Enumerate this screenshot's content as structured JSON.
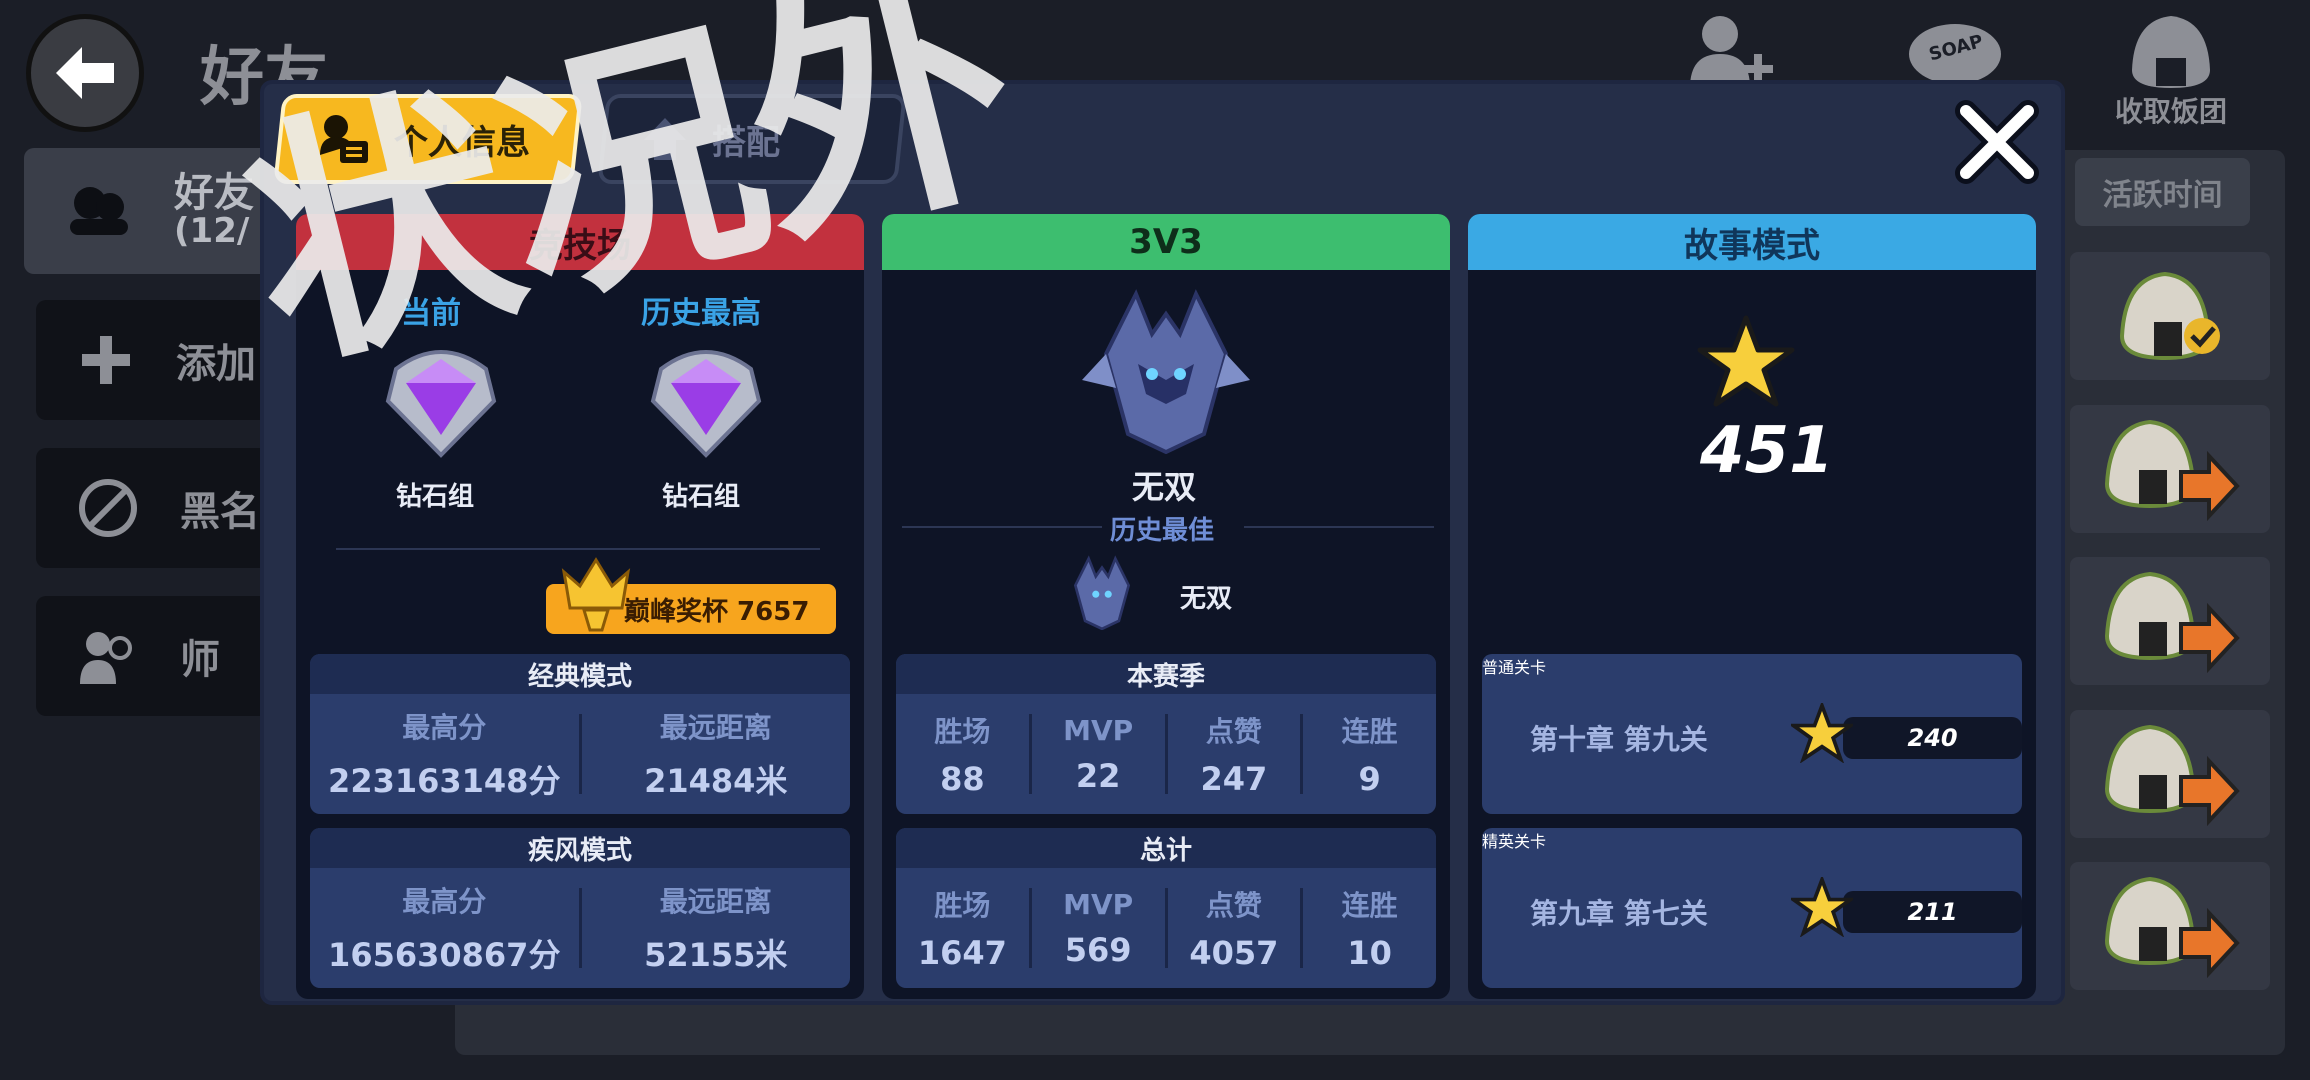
{
  "background": {
    "title": "好友",
    "top_icons": [
      {
        "name": "add-friend-icon",
        "label": ""
      },
      {
        "name": "soap-icon",
        "label": "SOAP"
      },
      {
        "name": "rice-ball-icon",
        "label": "收取饭团"
      }
    ],
    "sidebar": {
      "friends_label": "好友",
      "friends_count": "(12/",
      "add_label": "添加",
      "blacklist_label": "黑名",
      "mentor_label": "师"
    },
    "active_time_label": "活跃时间"
  },
  "modal": {
    "tabs": {
      "info": "个人信息",
      "match": "搭配"
    },
    "arena": {
      "header": "竞技场",
      "current_label": "当前",
      "best_label": "历史最高",
      "current_rank": "钻石组",
      "best_rank": "钻石组",
      "trophy_text": "巅峰奖杯 7657",
      "classic": {
        "title": "经典模式",
        "high_label": "最高分",
        "high_value": "223163148分",
        "dist_label": "最远距离",
        "dist_value": "21484米"
      },
      "wind": {
        "title": "疾风模式",
        "high_label": "最高分",
        "high_value": "165630867分",
        "dist_label": "最远距离",
        "dist_value": "52155米"
      }
    },
    "v3": {
      "header": "3V3",
      "rank": "无双",
      "best_label": "历史最佳",
      "best_rank": "无双",
      "season": {
        "title": "本赛季",
        "cells": [
          {
            "label": "胜场",
            "value": "88"
          },
          {
            "label": "MVP",
            "value": "22"
          },
          {
            "label": "点赞",
            "value": "247"
          },
          {
            "label": "连胜",
            "value": "9"
          }
        ]
      },
      "total": {
        "title": "总计",
        "cells": [
          {
            "label": "胜场",
            "value": "1647"
          },
          {
            "label": "MVP",
            "value": "569"
          },
          {
            "label": "点赞",
            "value": "4057"
          },
          {
            "label": "连胜",
            "value": "10"
          }
        ]
      }
    },
    "story": {
      "header": "故事模式",
      "stars_total": "451",
      "normal": {
        "title": "普通关卡",
        "stage": "第十章 第九关",
        "stars": "240"
      },
      "elite": {
        "title": "精英关卡",
        "stage": "第九章 第七关",
        "stars": "211"
      }
    }
  },
  "watermark": "状况外",
  "colors": {
    "accent_yellow": "#f7b81f",
    "arena_red": "#c2313e",
    "v3_green": "#3dbe6f",
    "story_blue": "#3aa9e4"
  }
}
